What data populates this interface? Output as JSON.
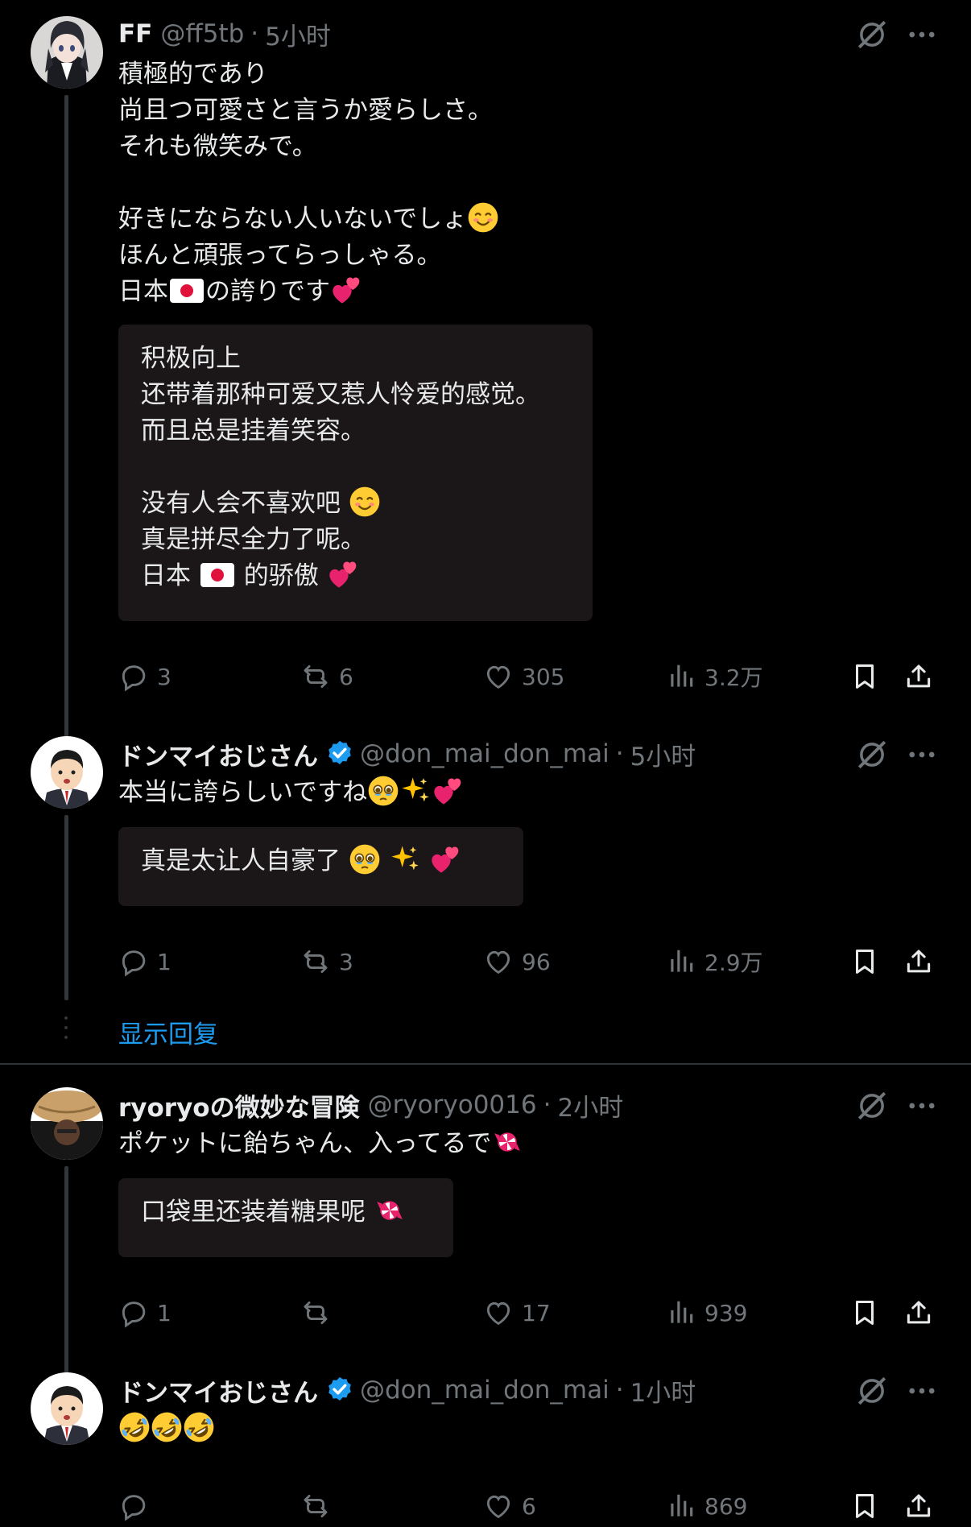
{
  "tweets": [
    {
      "display_name": "FF",
      "handle": "@ff5tb",
      "time": "5小时",
      "verified": false,
      "avatar": "anime-girl-avatar",
      "text_lines": [
        "積極的であり",
        "尚且つ可愛さと言うか愛らしさ。",
        "それも微笑みで。",
        "",
        "好きにならない人いないでしょ",
        "ほんと頑張ってらっしゃる。",
        "日本",
        "の誇りです"
      ],
      "translation_lines": [
        "积极向上",
        "还带着那种可爱又惹人怜爱的感觉。",
        "而且总是挂着笑容。",
        "",
        "没有人会不喜欢吧",
        "真是拼尽全力了呢。",
        "日本",
        "的骄傲"
      ],
      "replies": "3",
      "reposts": "6",
      "likes": "305",
      "views": "3.2万"
    },
    {
      "display_name": "ドンマイおじさん",
      "handle": "@don_mai_don_mai",
      "time": "5小时",
      "verified": true,
      "avatar": "salaryman-avatar",
      "text_lines": [
        "本当に誇らしいですね"
      ],
      "translation_lines": [
        "真是太让人自豪了"
      ],
      "replies": "1",
      "reposts": "3",
      "likes": "96",
      "views": "2.9万"
    },
    {
      "display_name": "ryoryoの微妙な冒険",
      "handle": "@ryoryo0016",
      "time": "2小时",
      "verified": false,
      "avatar": "straw-hat-avatar",
      "text_lines": [
        "ポケットに飴ちゃん、入ってるで"
      ],
      "translation_lines": [
        "口袋里还装着糖果呢"
      ],
      "replies": "1",
      "reposts": "",
      "likes": "17",
      "views": "939"
    },
    {
      "display_name": "ドンマイおじさん",
      "handle": "@don_mai_don_mai",
      "time": "1小时",
      "verified": true,
      "avatar": "salaryman-avatar",
      "text_lines": [
        ""
      ],
      "emoji": "rolling-laughing-emoji x3",
      "replies": "",
      "reposts": "",
      "likes": "6",
      "views": "869"
    }
  ],
  "show_replies_label": "显示回复",
  "separator": "·",
  "icons": [
    "grok-icon",
    "more-icon",
    "reply-icon",
    "repost-icon",
    "like-icon",
    "views-icon",
    "bookmark-icon",
    "share-icon",
    "verified-badge-icon"
  ],
  "colors": {
    "background": "#000000",
    "text": "#e7e9ea",
    "muted": "#71767b",
    "link": "#1d9bf0",
    "verified": "#1d9bf0",
    "translation_box": "#1b1718"
  }
}
